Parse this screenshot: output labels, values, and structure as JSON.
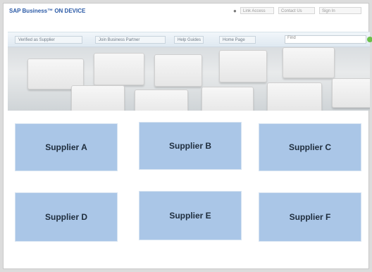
{
  "header": {
    "brand": "SAP Business™ ON DEVICE",
    "links": [
      "Link Access",
      "Contact Us",
      "Sign In"
    ]
  },
  "nav": {
    "tabs": [
      "Verified as Supplier",
      "Join Business Partner",
      "Help Guides",
      "Home Page"
    ],
    "search_placeholder": "Find"
  },
  "suppliers": [
    {
      "name": "Supplier A"
    },
    {
      "name": "Supplier B"
    },
    {
      "name": "Supplier C"
    },
    {
      "name": "Supplier D"
    },
    {
      "name": "Supplier E"
    },
    {
      "name": "Supplier F"
    }
  ],
  "colors": {
    "tile": "#aac6e7",
    "brand": "#2b5aa6",
    "search_go": "#6cc04a"
  }
}
